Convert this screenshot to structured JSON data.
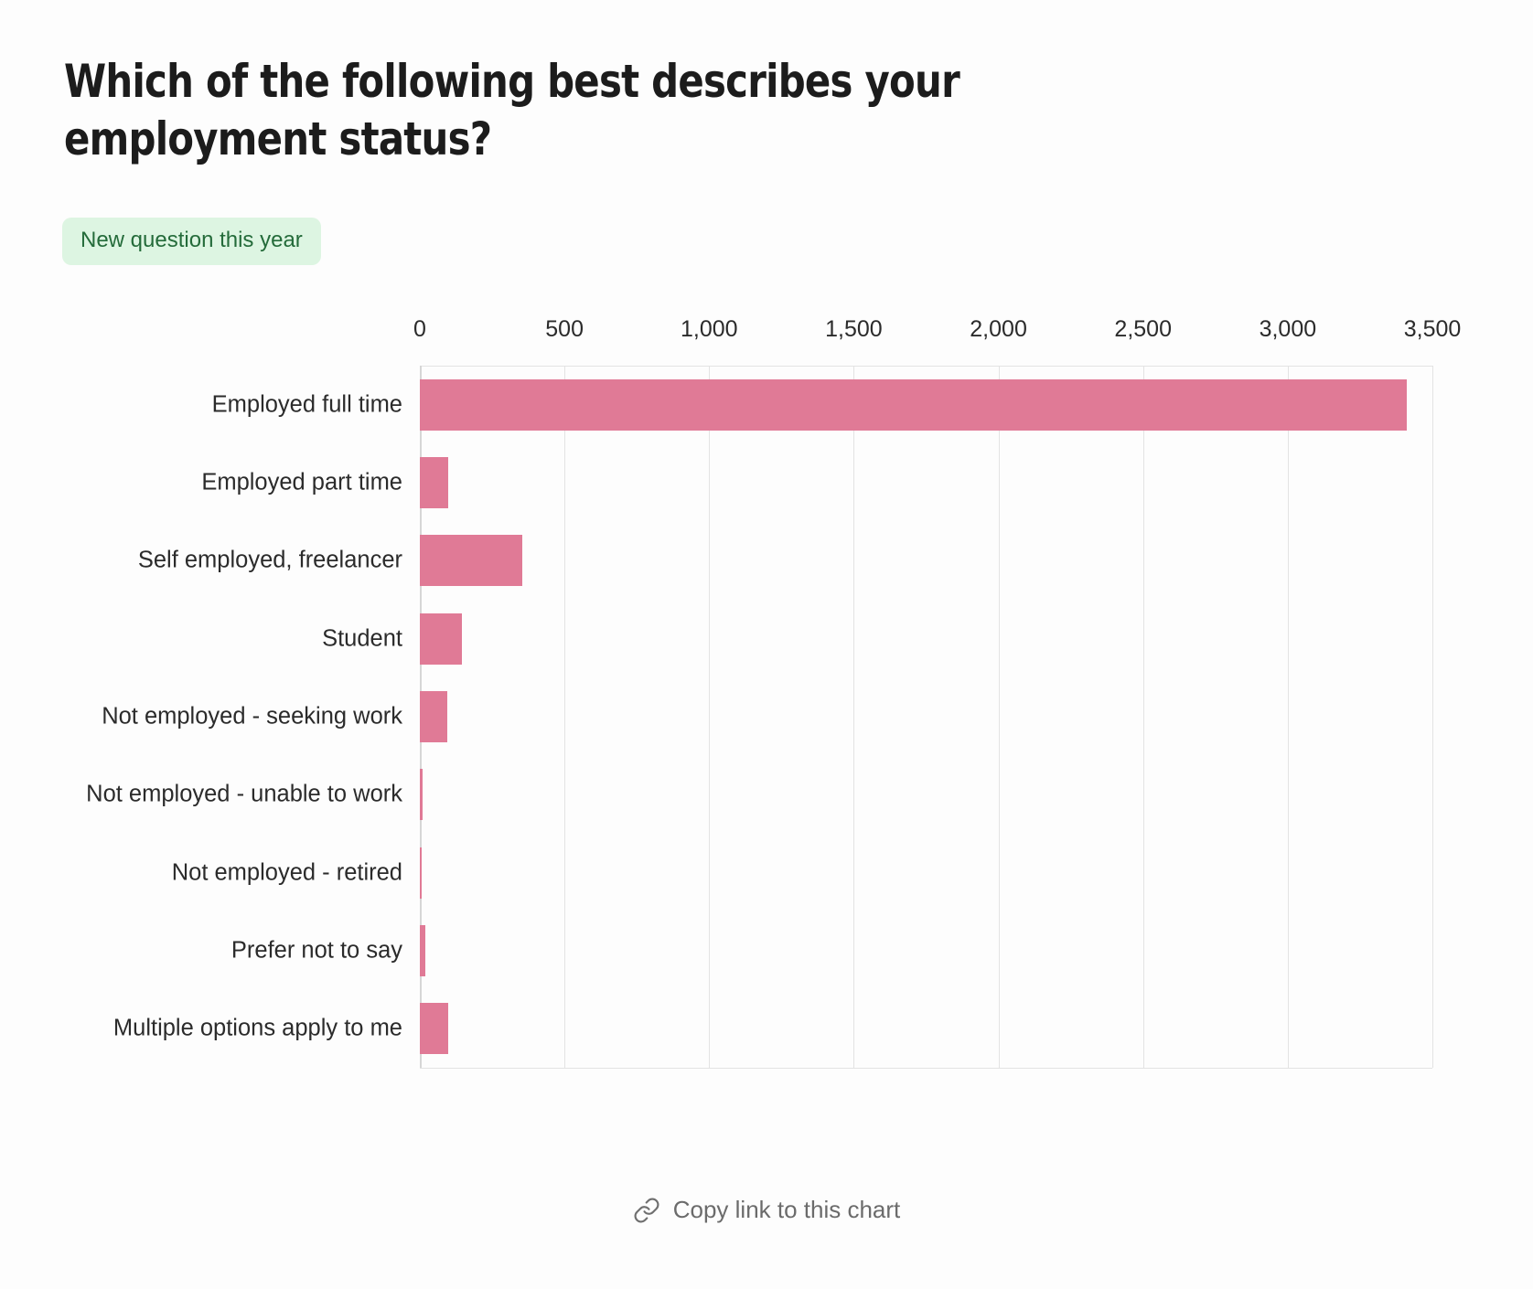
{
  "header": {
    "title": "Which of the following best describes your employment status?",
    "badge_label": "New question this year",
    "badge_bg": "#ddf5e2",
    "badge_color": "#246b3a"
  },
  "footer": {
    "copy_link_label": "Copy link to this chart",
    "icon": "link-icon"
  },
  "chart_data": {
    "type": "bar",
    "orientation": "horizontal",
    "title": "Which of the following best describes your employment status?",
    "xlabel": "",
    "ylabel": "",
    "xlim": [
      0,
      3500
    ],
    "grid": true,
    "legend": null,
    "bar_color": "#e07a96",
    "x_ticks": [
      0,
      500,
      1000,
      1500,
      2000,
      2500,
      3000,
      3500
    ],
    "x_tick_labels": [
      "0",
      "500",
      "1,000",
      "1,500",
      "2,000",
      "2,500",
      "3,000",
      "3,500"
    ],
    "categories": [
      "Employed full time",
      "Employed part time",
      "Self employed, freelancer",
      "Student",
      "Not employed - seeking work",
      "Not employed - unable to work",
      "Not employed - retired",
      "Prefer not to say",
      "Multiple options apply to me"
    ],
    "values": [
      3412,
      98,
      353,
      147,
      95,
      8,
      5,
      18,
      98
    ]
  }
}
